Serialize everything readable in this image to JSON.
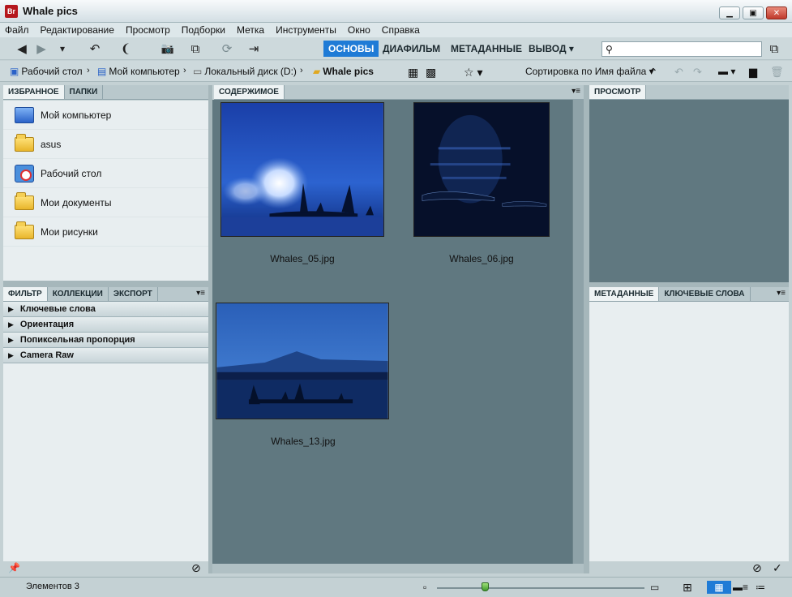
{
  "window": {
    "title": "Whale pics",
    "app_icon": "Br"
  },
  "window_controls": {
    "minimize": "▁",
    "maximize": "▣",
    "close": "✕"
  },
  "menu": [
    "Файл",
    "Редактирование",
    "Просмотр",
    "Подборки",
    "Метка",
    "Инструменты",
    "Окно",
    "Справка"
  ],
  "workspaces": [
    {
      "label": "ОСНОВЫ",
      "active": true
    },
    {
      "label": "ДИАФИЛЬМ",
      "active": false
    },
    {
      "label": "МЕТАДАННЫЕ",
      "active": false
    },
    {
      "label": "ВЫВОД ▾",
      "active": false
    }
  ],
  "search": {
    "icon": "search-icon",
    "value": "",
    "placeholder": ""
  },
  "toolbar_icons": {
    "back": "◀",
    "forward": "▶",
    "history": "▾",
    "rotate_ccw": "↶",
    "boomerang": "❨",
    "camera": "📷",
    "copy": "⧉",
    "refresh": "⟳",
    "export": "⇥",
    "compact": "⧉"
  },
  "breadcrumbs": [
    {
      "label": "Рабочий стол",
      "icon": "desktop-icon"
    },
    {
      "label": "Мой компьютер",
      "icon": "computer-icon"
    },
    {
      "label": "Локальный диск (D:)",
      "icon": "drive-icon"
    },
    {
      "label": "Whale pics",
      "icon": "folder-icon"
    }
  ],
  "crumb_separator": "›",
  "sort": {
    "label": "Сортировка по Имя файла ▾",
    "up": "⌃"
  },
  "path_icons": {
    "filter_grid": "▦",
    "quality": "▩",
    "star": "☆ ▾",
    "undo": "↶",
    "redo": "↷",
    "open_folder": "▬ ▾",
    "new_folder": "▆",
    "trash": "🗑"
  },
  "left_tabs": [
    {
      "label": "ИЗБРАННОЕ",
      "active": true
    },
    {
      "label": "ПАПКИ",
      "active": false
    }
  ],
  "favorites": [
    {
      "label": "Мой компьютер",
      "icon": "computer"
    },
    {
      "label": "asus",
      "icon": "folder"
    },
    {
      "label": "Рабочий стол",
      "icon": "desktop"
    },
    {
      "label": "Мои документы",
      "icon": "folder"
    },
    {
      "label": "Мои рисунки",
      "icon": "folder"
    }
  ],
  "filter_tabs": [
    {
      "label": "ФИЛЬТР",
      "active": true
    },
    {
      "label": "КОЛЛЕКЦИИ",
      "active": false
    },
    {
      "label": "ЭКСПОРТ",
      "active": false
    }
  ],
  "filter_rows": [
    "Ключевые слова",
    "Ориентация",
    "Попиксельная пропорция",
    "Camera Raw"
  ],
  "panel_menu": "▾≡",
  "content_tab": "СОДЕРЖИМОЕ",
  "thumbnails": [
    {
      "filename": "Whales_05.jpg"
    },
    {
      "filename": "Whales_06.jpg"
    },
    {
      "filename": "Whales_13.jpg"
    }
  ],
  "preview_tab": "ПРОСМОТР",
  "meta_tabs": [
    {
      "label": "МЕТАДАННЫЕ",
      "active": true
    },
    {
      "label": "КЛЮЧЕВЫЕ СЛОВА",
      "active": false
    }
  ],
  "status": {
    "items_count": "Элементов 3"
  },
  "status_icons": {
    "pin": "📌",
    "no": "⊘",
    "check": "✓",
    "small": "▫",
    "large": "▭",
    "grid": "⊞",
    "thumbs": "▦",
    "details": "▬≡",
    "list": "≔"
  },
  "colors": {
    "accent": "#1f7bd6",
    "content_bg": "#607880",
    "panel_bg": "#e8eef0"
  }
}
